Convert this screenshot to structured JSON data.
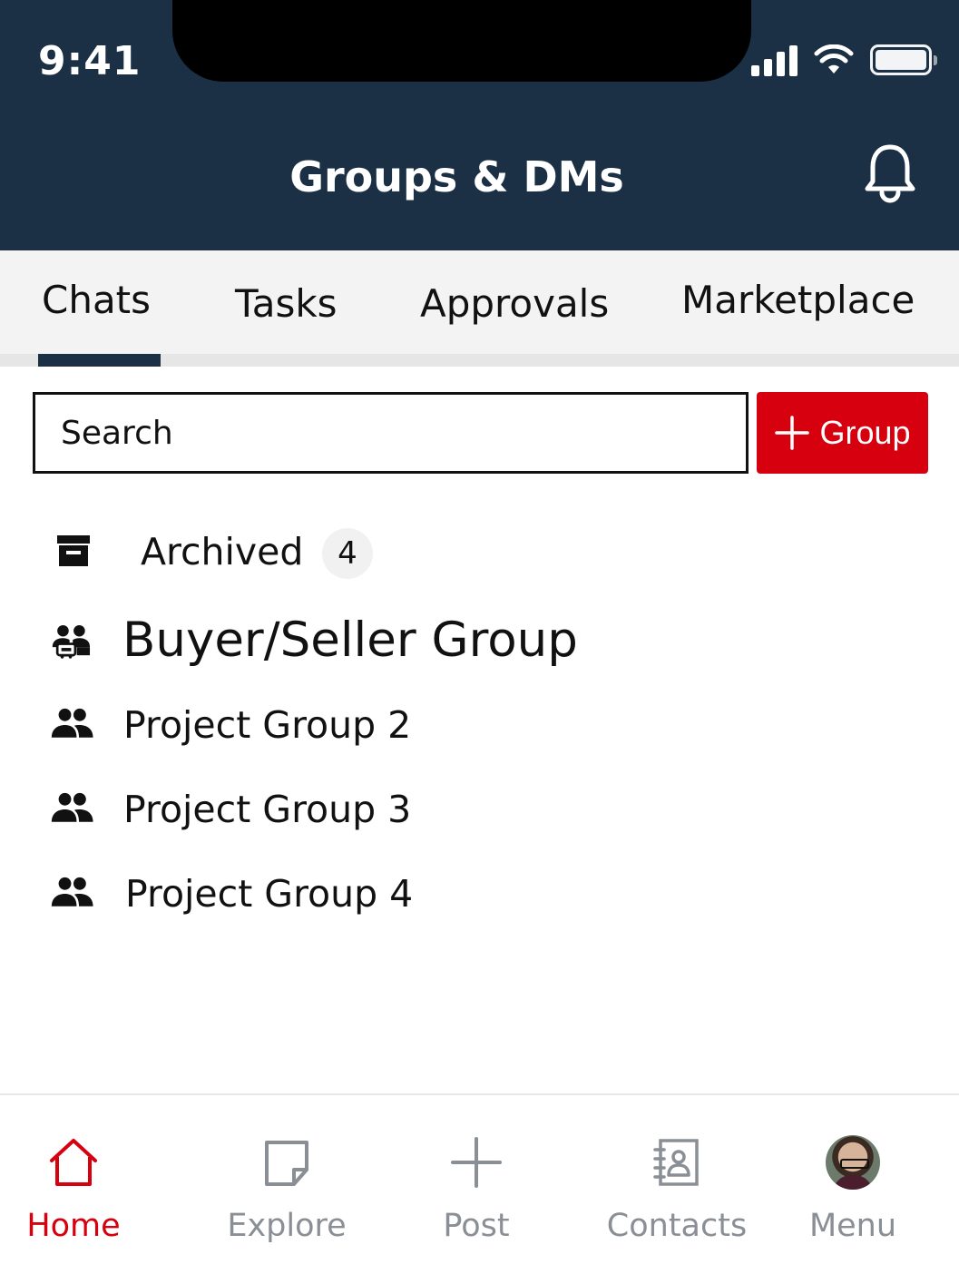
{
  "status_bar": {
    "time": "9:41"
  },
  "header": {
    "title": "Groups & DMs"
  },
  "tabs": [
    {
      "label": "Chats",
      "active": true
    },
    {
      "label": "Tasks",
      "active": false
    },
    {
      "label": "Approvals",
      "active": false
    },
    {
      "label": "Marketplace",
      "active": false
    }
  ],
  "search": {
    "placeholder": "Search"
  },
  "add_group_button": {
    "label": "Group"
  },
  "archived": {
    "label": "Archived",
    "count": "4"
  },
  "groups": [
    {
      "label": "Buyer/Seller Group",
      "icon": "buyer-seller-group-icon"
    },
    {
      "label": "Project Group 2",
      "icon": "group-icon"
    },
    {
      "label": "Project Group 3",
      "icon": "group-icon"
    },
    {
      "label": "Project Group 4",
      "icon": "group-icon"
    }
  ],
  "bottom_nav": [
    {
      "label": "Home",
      "icon": "home-icon",
      "active": true
    },
    {
      "label": "Explore",
      "icon": "note-icon",
      "active": false
    },
    {
      "label": "Post",
      "icon": "plus-icon",
      "active": false
    },
    {
      "label": "Contacts",
      "icon": "contacts-book-icon",
      "active": false
    },
    {
      "label": "Menu",
      "icon": "avatar",
      "active": false
    }
  ],
  "colors": {
    "header": "#1b3045",
    "accent": "#d6000f",
    "nav_inactive": "#8a8f96"
  }
}
